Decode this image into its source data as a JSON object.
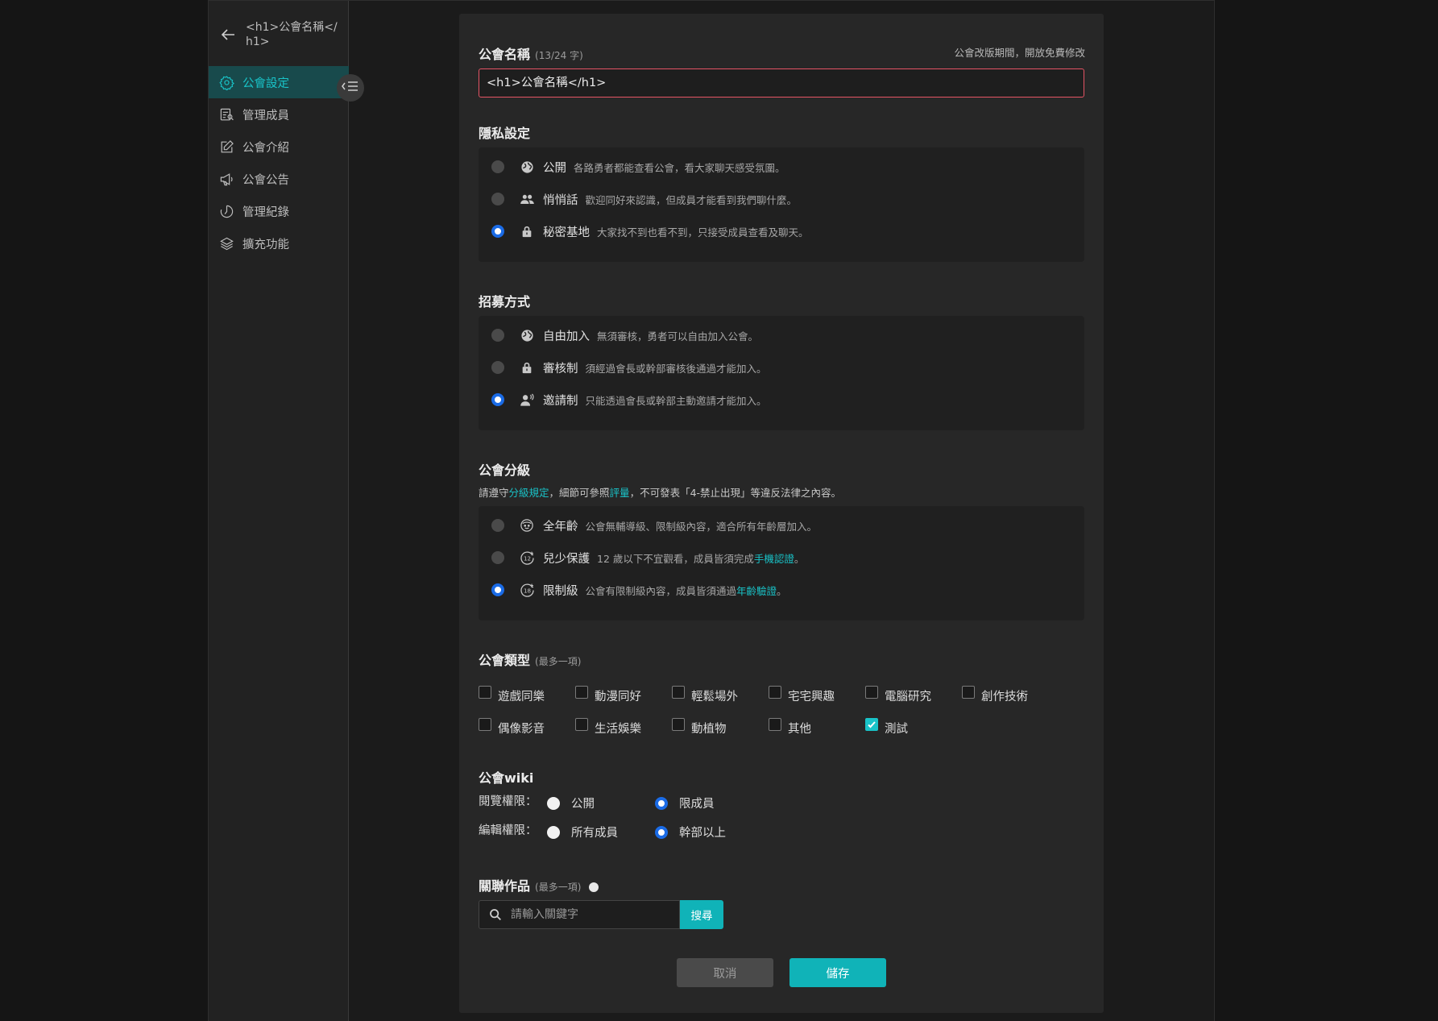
{
  "sidebar": {
    "title": "<h1>公會名稱</h1>",
    "items": [
      {
        "label": "公會設定",
        "icon": "gear-icon",
        "active": true
      },
      {
        "label": "管理成員",
        "icon": "member-list-icon"
      },
      {
        "label": "公會介紹",
        "icon": "edit-icon"
      },
      {
        "label": "公會公告",
        "icon": "megaphone-icon"
      },
      {
        "label": "管理紀錄",
        "icon": "history-icon"
      },
      {
        "label": "擴充功能",
        "icon": "layers-icon"
      }
    ]
  },
  "guild_name": {
    "title": "公會名稱",
    "count": "(13/24 字)",
    "note": "公會改版期間，開放免費修改",
    "value": "<h1>公會名稱</h1>"
  },
  "privacy": {
    "title": "隱私設定",
    "options": [
      {
        "label": "公開",
        "desc": "各路勇者都能查看公會，看大家聊天感受氛圍。",
        "icon": "globe-icon"
      },
      {
        "label": "悄悄話",
        "desc": "歡迎同好來認識，但成員才能看到我們聊什麼。",
        "icon": "people-icon"
      },
      {
        "label": "秘密基地",
        "desc": "大家找不到也看不到，只接受成員查看及聊天。",
        "icon": "lock-icon"
      }
    ],
    "selected": 2
  },
  "recruit": {
    "title": "招募方式",
    "options": [
      {
        "label": "自由加入",
        "desc": "無須審核，勇者可以自由加入公會。",
        "icon": "globe-icon"
      },
      {
        "label": "審核制",
        "desc": "須經過會長或幹部審核後通過才能加入。",
        "icon": "lock-icon"
      },
      {
        "label": "邀請制",
        "desc": "只能透過會長或幹部主動邀請才能加入。",
        "icon": "invite-icon"
      }
    ],
    "selected": 2
  },
  "rating": {
    "title": "公會分級",
    "note_pre": "請遵守",
    "note_link1": "分級規定",
    "note_mid": "，細節可參照",
    "note_link2": "評量",
    "note_post": "，不可發表「4-禁止出現」等違反法律之內容。",
    "options": [
      {
        "label": "全年齡",
        "desc": "公會無輔導級、限制級內容，適合所有年齡層加入。",
        "icon": "smile-face-icon"
      },
      {
        "label": "兒少保護",
        "desc": "12 歲以下不宜觀看，成員皆須完成",
        "link": "手機認證",
        "tail": "。",
        "icon": "age-12-icon"
      },
      {
        "label": "限制級",
        "desc": "公會有限制級內容，成員皆須通過",
        "link": "年齡驗證",
        "tail": "。",
        "icon": "age-18-icon"
      }
    ],
    "selected": 2
  },
  "types": {
    "title": "公會類型",
    "hint": "(最多一項)",
    "items": [
      "遊戲同樂",
      "動漫同好",
      "輕鬆場外",
      "宅宅興趣",
      "電腦研究",
      "創作技術",
      "偶像影音",
      "生活娛樂",
      "動植物",
      "其他",
      "測試"
    ],
    "checked": "測試"
  },
  "wiki": {
    "title": "公會wiki",
    "view_label": "閱覽權限：",
    "view_options": [
      "公開",
      "限成員"
    ],
    "edit_label": "編輯權限：",
    "edit_options": [
      "所有成員",
      "幹部以上"
    ]
  },
  "related": {
    "title": "關聯作品",
    "hint": "(最多一項)",
    "placeholder": "請輸入關鍵字",
    "search_label": "搜尋"
  },
  "actions": {
    "cancel": "取消",
    "save": "儲存"
  },
  "colors": {
    "accent": "#10b3b8",
    "radio_selected": "#1a6be6",
    "input_error_border": "#e55465"
  }
}
